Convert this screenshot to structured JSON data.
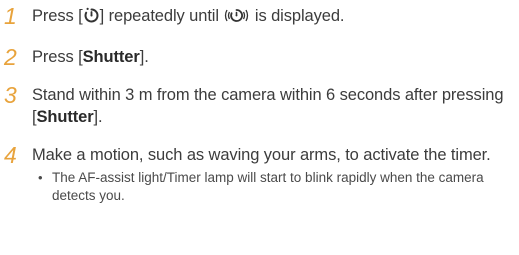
{
  "steps": [
    {
      "number": "1",
      "parts": {
        "a": "Press [",
        "b": "] repeatedly until ",
        "c": " is displayed."
      },
      "icons": [
        "self-timer-icon",
        "motion-timer-icon"
      ]
    },
    {
      "number": "2",
      "parts": {
        "a": "Press [",
        "bold": "Shutter",
        "b": "]."
      }
    },
    {
      "number": "3",
      "parts": {
        "a": "Stand within 3 m from the camera within 6 seconds after pressing [",
        "bold": "Shutter",
        "b": "]."
      }
    },
    {
      "number": "4",
      "text": "Make a motion, such as waving your arms, to activate the timer.",
      "bullet": "•",
      "note": "The AF-assist light/Timer lamp will start to blink rapidly when the camera detects you."
    }
  ],
  "colors": {
    "step_number": "#e8a33c",
    "text": "#3c3c3c"
  }
}
